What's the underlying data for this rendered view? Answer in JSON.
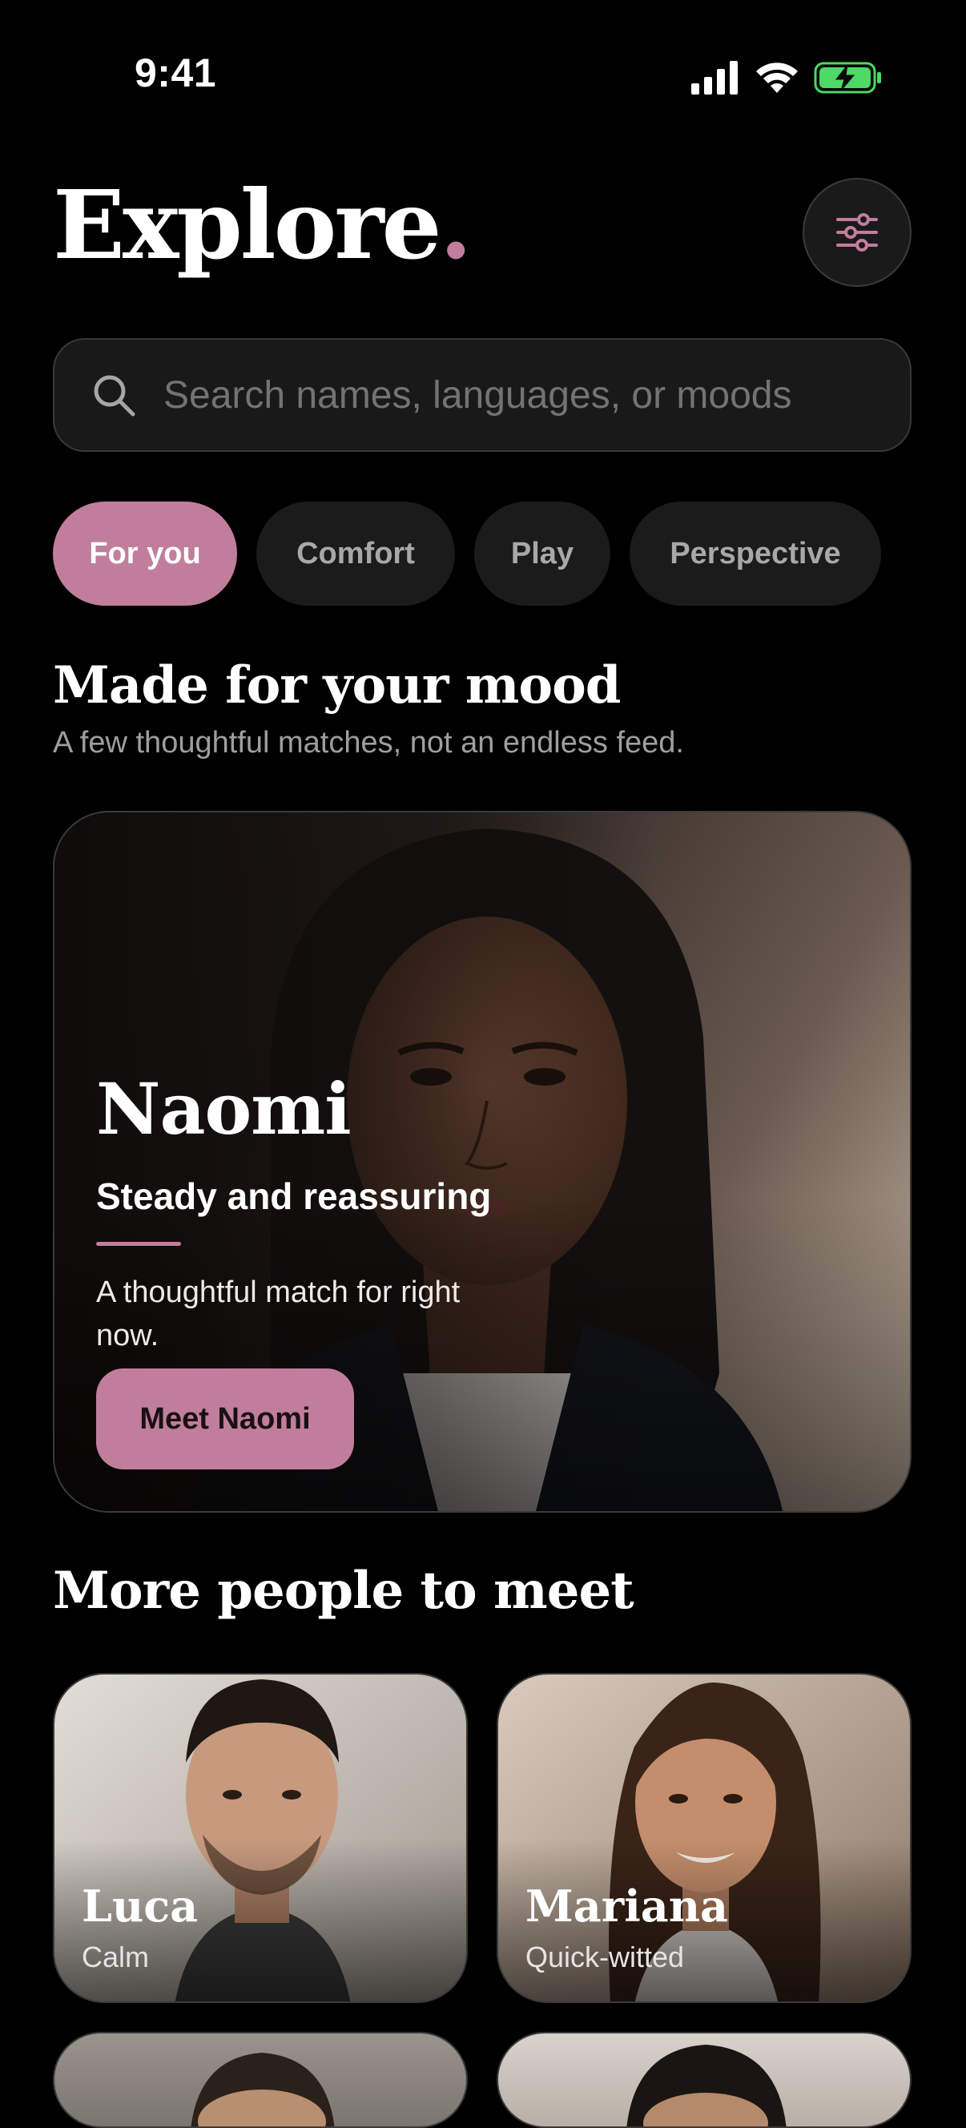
{
  "status_bar": {
    "time": "9:41"
  },
  "header": {
    "title": "Explore",
    "title_dot": ".",
    "filter_icon": "sliders-icon"
  },
  "search": {
    "placeholder": "Search names, languages, or moods",
    "value": ""
  },
  "chips": [
    {
      "label": "For you",
      "active": true
    },
    {
      "label": "Comfort",
      "active": false
    },
    {
      "label": "Play",
      "active": false
    },
    {
      "label": "Perspective",
      "active": false
    }
  ],
  "featured": {
    "heading": "Made for your mood",
    "subheading": "A few thoughtful matches, not an endless feed.",
    "name": "Naomi",
    "tagline": "Steady and reassuring",
    "blurb": "A thoughtful match for right now.",
    "button_label": "Meet Naomi"
  },
  "more": {
    "heading": "More people to meet",
    "people": [
      {
        "name": "Luca",
        "mood": "Calm"
      },
      {
        "name": "Mariana",
        "mood": "Quick-witted"
      }
    ]
  },
  "colors": {
    "accent": "#c17e9c",
    "background": "#000000",
    "surface": "#1c1b1c"
  }
}
